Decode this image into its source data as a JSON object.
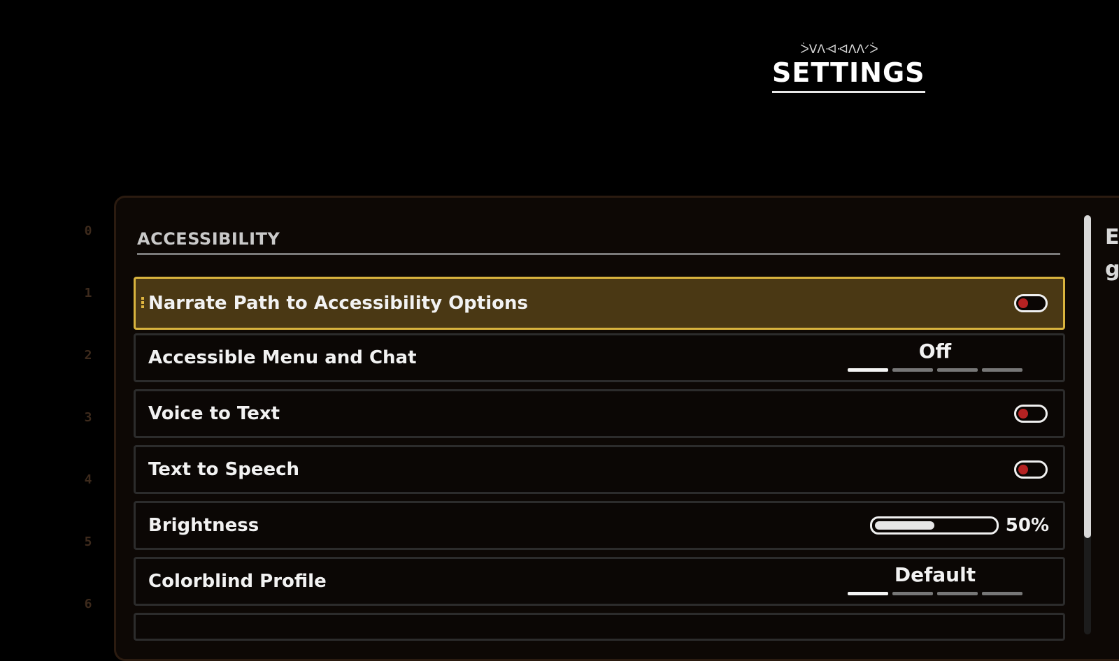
{
  "header": {
    "alien_glyphs": "ᐴᐯᐱᐗᐗᐱᐱᐟᐴ",
    "title": "SETTINGS"
  },
  "side_numbers": [
    "0",
    "1",
    "2",
    "3",
    "4",
    "5",
    "6"
  ],
  "section": {
    "title": "ACCESSIBILITY"
  },
  "settings": [
    {
      "label": "Narrate Path to Accessibility Options",
      "control": "toggle",
      "state": "off"
    },
    {
      "label": "Accessible Menu and Chat",
      "control": "selector",
      "value": "Off",
      "segments": 4,
      "active_segment": 1
    },
    {
      "label": "Voice to Text",
      "control": "toggle",
      "state": "off"
    },
    {
      "label": "Text to Speech",
      "control": "toggle",
      "state": "off"
    },
    {
      "label": "Brightness",
      "control": "slider",
      "value": "50%",
      "fraction": 0.5
    },
    {
      "label": "Colorblind Profile",
      "control": "selector",
      "value": "Default",
      "segments": 4,
      "active_segment": 1
    }
  ],
  "right_panel_partial_text": [
    "E",
    "g"
  ],
  "colors": {
    "selected_bg": "#4a3814",
    "selected_border": "#d8b33e",
    "toggle_knob": "#b52222"
  }
}
